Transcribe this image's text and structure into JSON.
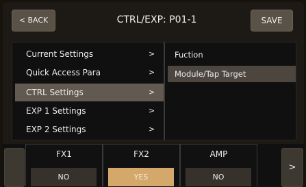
{
  "header": {
    "back_label": "< BACK",
    "title": "CTRL/EXP: P01-1",
    "save_label": "SAVE"
  },
  "menu": {
    "items": [
      {
        "label": "Current Settings",
        "arrow": ">"
      },
      {
        "label": "Quick Access Para",
        "arrow": ">"
      },
      {
        "label": "CTRL Settings",
        "arrow": ">",
        "selected": true
      },
      {
        "label": "EXP 1 Settings",
        "arrow": ">"
      },
      {
        "label": "EXP 2 Settings",
        "arrow": ">"
      }
    ],
    "submenu": [
      {
        "label": "Fuction"
      },
      {
        "label": "Module/Tap Target",
        "selected": true
      }
    ]
  },
  "bottom": {
    "next_label": ">",
    "slots": [
      {
        "name": "FX1",
        "value": "NO"
      },
      {
        "name": "FX2",
        "value": "YES"
      },
      {
        "name": "AMP",
        "value": "NO"
      }
    ]
  },
  "colors": {
    "accent_on": "#d4a76a",
    "selected_row": "#625a50",
    "button": "#5a5246"
  },
  "icons": {
    "item_arrow": "chevron-right-icon"
  }
}
